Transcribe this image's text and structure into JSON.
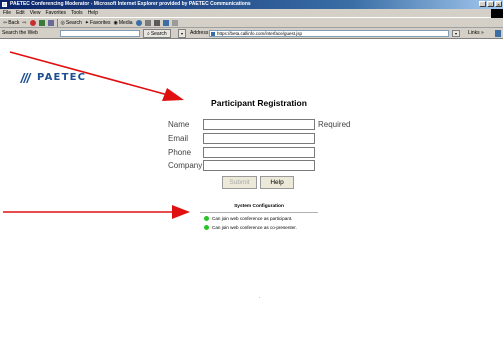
{
  "browser": {
    "title": "PAETEC Conferencing Moderator - Microsoft Internet Explorer provided by PAETEC Communications",
    "window_buttons": [
      "_",
      "□",
      "×"
    ],
    "menu": [
      "File",
      "Edit",
      "View",
      "Favorites",
      "Tools",
      "Help"
    ],
    "toolbar": {
      "back": "Back",
      "search": "Search",
      "favorites": "Favorites",
      "media": "Media"
    },
    "search_bar": {
      "label": "Search the Web",
      "button": "Search",
      "dropdown": "▾"
    },
    "address": {
      "label": "Address",
      "url": "https://beta.callinfo.com/interface/guest.jsp",
      "dropdown": "▾",
      "links": "Links »"
    }
  },
  "brand": {
    "logo_text": "PAETEC",
    "logo_color": "#1d4f91"
  },
  "form": {
    "title": "Participant Registration",
    "fields": [
      {
        "label": "Name",
        "value": ""
      },
      {
        "label": "Email",
        "value": ""
      },
      {
        "label": "Phone",
        "value": ""
      },
      {
        "label": "Company",
        "value": ""
      }
    ],
    "required_note": "Required",
    "submit_label": "Submit",
    "help_label": "Help"
  },
  "system_config": {
    "title": "System Configuration",
    "items": [
      {
        "text": "Can join web conference as participant.",
        "status_color": "#28c428"
      },
      {
        "text": "Can join web conference as co-presenter.",
        "status_color": "#28c428"
      }
    ]
  },
  "annotations": {
    "arrow_color": "#e01010"
  }
}
